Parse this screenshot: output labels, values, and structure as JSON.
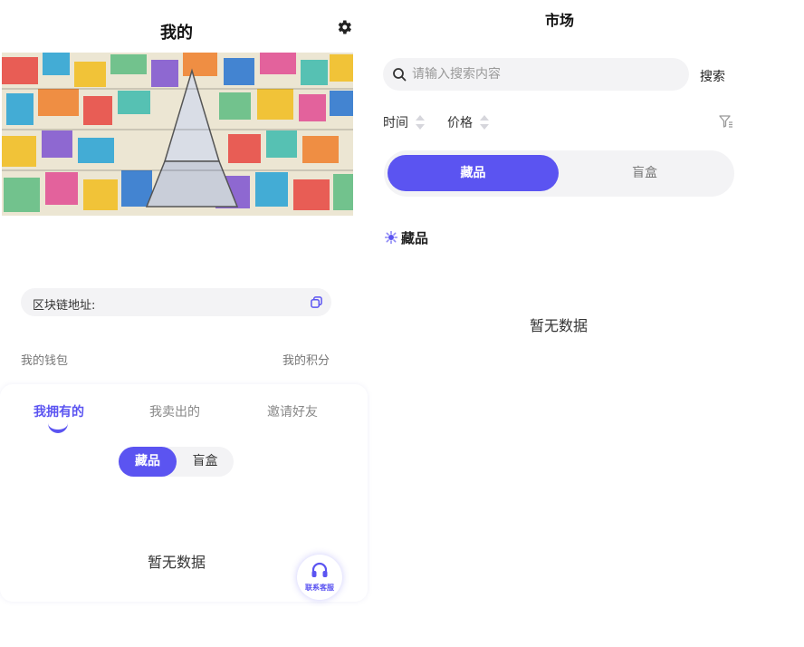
{
  "mine": {
    "title": "我的",
    "address_label": "区块链地址:",
    "wallet": "我的钱包",
    "points": "我的积分",
    "tabs": [
      "我拥有的",
      "我卖出的",
      "邀请好友"
    ],
    "segment": [
      "藏品",
      "盲盒"
    ],
    "empty": "暂无数据",
    "service_label": "联系客服"
  },
  "market": {
    "title": "市场",
    "search_placeholder": "请输入搜索内容",
    "search_button": "搜索",
    "sort_time": "时间",
    "sort_price": "价格",
    "segment": [
      "藏品",
      "盲盒"
    ],
    "section_title": "藏品",
    "empty": "暂无数据"
  },
  "colors": {
    "accent": "#5b54f1",
    "pill_bg": "#f3f3f5"
  },
  "icons": [
    "gear-icon",
    "copy-icon",
    "headset-icon",
    "search-icon",
    "sort-arrows-icon",
    "filter-icon",
    "star-icon"
  ]
}
